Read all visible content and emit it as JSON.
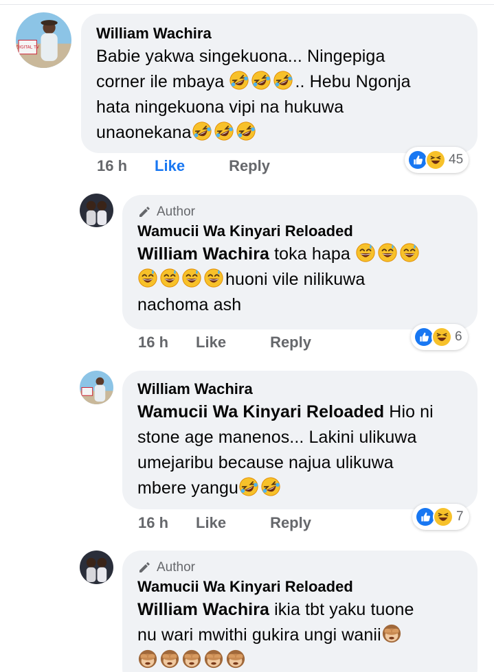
{
  "comments": [
    {
      "author": "William Wachira",
      "avatar_badge": "DIGITAL TV",
      "text_line1": "Babie yakwa singekuona... Ningepiga",
      "text_line2a": "corner ile mbaya ",
      "text_line2b": ".. Hebu Ngonja",
      "text_line3": "hata ningekuona vipi na hukuwa",
      "text_line4": "unaonekana",
      "time": "16 h",
      "like": "Like",
      "reply": "Reply",
      "reaction_count": "45"
    },
    {
      "author_label": "Author",
      "author": "Wamucii Wa Kinyari Reloaded",
      "mention": "William Wachira",
      "text_line1": " toka hapa ",
      "text_line2": "huoni vile nilikuwa",
      "text_line3": "nachoma ash",
      "time": "16 h",
      "like": "Like",
      "reply": "Reply",
      "reaction_count": "6"
    },
    {
      "author": "William Wachira",
      "mention": "Wamucii Wa Kinyari Reloaded",
      "text_line1": " Hio ni",
      "text_line2": "stone age manenos... Lakini ulikuwa",
      "text_line3": "umejaribu because najua ulikuwa",
      "text_line4": "mbere yangu",
      "time": "16 h",
      "like": "Like",
      "reply": "Reply",
      "reaction_count": "7"
    },
    {
      "author_label": "Author",
      "author": "Wamucii Wa Kinyari Reloaded",
      "mention": "William Wachira",
      "text_line1": " ikia tbt yaku tuone",
      "text_line2": "nu wari mwithi gukira ungi wanii"
    }
  ],
  "colors": {
    "like_blue": "#1877f2",
    "bubble_bg": "#f0f2f5",
    "meta_gray": "#65676b"
  },
  "icons": {
    "laughing": "rolling-on-floor-laughing-emoji",
    "sweat_smile": "grinning-sweat-emoji",
    "see_no_evil": "see-no-evil-monkey-emoji",
    "like_reaction": "thumbs-up-reaction-icon",
    "haha_reaction": "haha-reaction-icon",
    "author_pencil": "pencil-icon"
  }
}
